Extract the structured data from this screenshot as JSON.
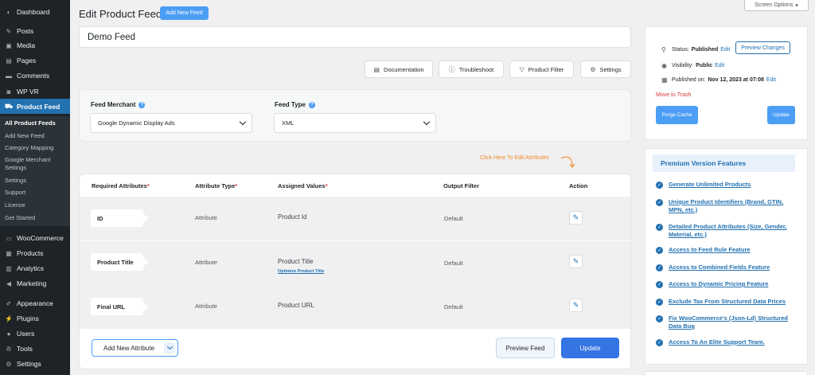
{
  "sidebar": {
    "items": [
      {
        "label": "Dashboard",
        "icon": "dashboard-icon",
        "glyph": "◐"
      },
      {
        "label": "Posts",
        "icon": "pin-icon",
        "glyph": "✎"
      },
      {
        "label": "Media",
        "icon": "media-icon",
        "glyph": "▣"
      },
      {
        "label": "Pages",
        "icon": "pages-icon",
        "glyph": "▤"
      },
      {
        "label": "Comments",
        "icon": "comment-icon",
        "glyph": "▬"
      },
      {
        "label": "WP VR",
        "icon": "vr-icon",
        "glyph": "◙"
      },
      {
        "label": "Product Feed",
        "icon": "cart-icon",
        "glyph": "⛟"
      },
      {
        "label": "WooCommerce",
        "icon": "woo-icon",
        "glyph": "▭"
      },
      {
        "label": "Products",
        "icon": "box-icon",
        "glyph": "▦"
      },
      {
        "label": "Analytics",
        "icon": "chart-icon",
        "glyph": "▥"
      },
      {
        "label": "Marketing",
        "icon": "megaphone-icon",
        "glyph": "◀"
      },
      {
        "label": "Appearance",
        "icon": "brush-icon",
        "glyph": "✐"
      },
      {
        "label": "Plugins",
        "icon": "plug-icon",
        "glyph": "⚡"
      },
      {
        "label": "Users",
        "icon": "user-icon",
        "glyph": "●"
      },
      {
        "label": "Tools",
        "icon": "wrench-icon",
        "glyph": "✇"
      },
      {
        "label": "Settings",
        "icon": "settings-icon",
        "glyph": "⚙"
      }
    ],
    "submenu": [
      "All Product Feeds",
      "Add New Feed",
      "Category Mapping",
      "Google Merchant",
      "Settings",
      "Settings",
      "Support",
      "License",
      "Get Started"
    ]
  },
  "header": {
    "title": "Edit Product Feed",
    "add_new": "Add New Feed",
    "screen_options": "Screen Options"
  },
  "feed_name": "Demo Feed",
  "toolbar": {
    "documentation": "Documentation",
    "troubleshoot": "Troubleshoot",
    "product_filter": "Product Filter",
    "settings": "Settings"
  },
  "merchant": {
    "label": "Feed Merchant",
    "value": "Google Dynamic Display Ads",
    "type_label": "Feed Type",
    "type_value": "XML"
  },
  "hint": "Click Here To Edit Attributes",
  "table": {
    "headers": {
      "required": "Required Attributes",
      "type": "Attribute Type",
      "values": "Assigned Values",
      "filter": "Output Filter",
      "action": "Action"
    },
    "required_mark": "*",
    "rows": [
      {
        "attribute": "ID",
        "type": "Attribute",
        "value": "Product Id",
        "filter": "Default",
        "link": ""
      },
      {
        "attribute": "Product Title",
        "type": "Attribute",
        "value": "Product Title",
        "filter": "Default",
        "link": "Optimize Product Title"
      },
      {
        "attribute": "Final URL",
        "type": "Attribute",
        "value": "Product URL",
        "filter": "Default",
        "link": ""
      }
    ],
    "add_attribute": "Add New Attribute",
    "preview": "Preview Feed",
    "update": "Update"
  },
  "publish": {
    "status_label": "Status:",
    "status_value": "Published",
    "edit": "Edit",
    "preview_changes": "Preview Changes",
    "visibility_label": "Visibility:",
    "visibility_value": "Public",
    "published_label": "Published on:",
    "published_value": "Nov 12, 2023 at 07:08",
    "trash": "Move to Trash",
    "purge": "Purge Cache",
    "update": "Update"
  },
  "premium": {
    "title": "Premium Version Features",
    "features": [
      "Generate Unlimited Products",
      "Unique Product Identifiers (Brand, GTIN, MPN, etc.)",
      "Detailed Product Attributes (Size, Gender, Material, etc.)",
      "Access to Feed Rule Feature",
      "Access to Combined Fields Feature",
      "Access to Dynamic Pricing Feature",
      "Exclude Tax From Structured Data Prices",
      "Fix WooCommerce's (Json-Ld) Structured Data Bug",
      "Access To An Elite Support Team."
    ]
  },
  "colors": {
    "sidebar_bg": "#1d2327",
    "accent": "#2271b1",
    "button_blue": "#4c9ef5",
    "update_blue": "#3574e3",
    "hint_orange": "#f08a24",
    "danger": "#d63638"
  }
}
